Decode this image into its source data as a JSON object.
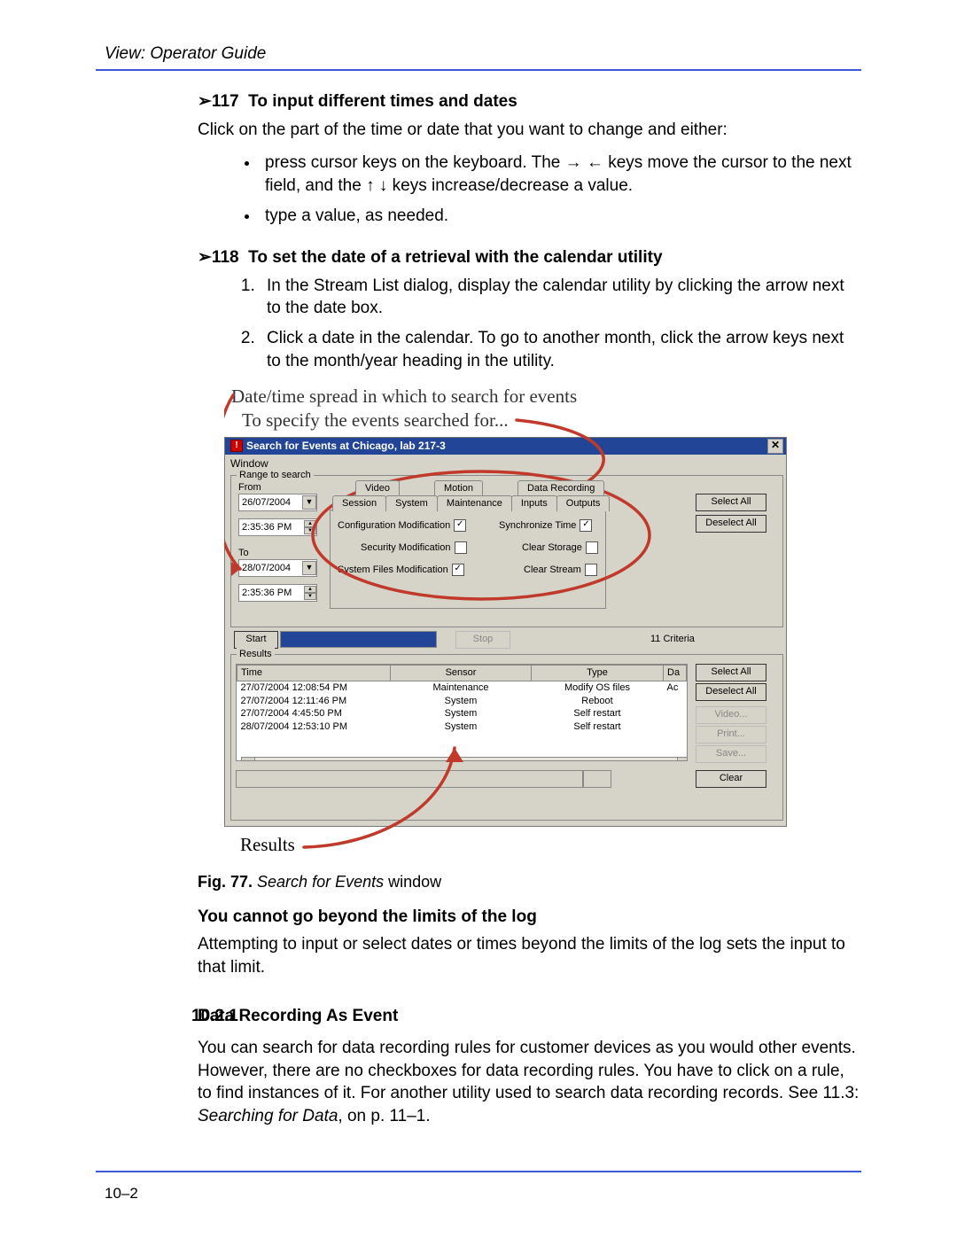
{
  "header": {
    "title": "View: Operator Guide"
  },
  "sec117": {
    "num": "117",
    "title": "To input different times and dates",
    "intro": "Click on the part of the time or date that you want to change and either:",
    "bullets": [
      "press cursor keys on the keyboard. The → ← keys move the cursor to the next field, and the ↑ ↓ keys increase/decrease a value.",
      "type a value, as needed."
    ]
  },
  "sec118": {
    "num": "118",
    "title": "To set the date of a retrieval with the calendar utility",
    "steps": [
      "In the Stream List dialog, display the calendar utility by clicking the arrow next to the date box.",
      "Click a date in the calendar. To go to another month, click the arrow keys next to the month/year heading in the utility."
    ]
  },
  "figure": {
    "anno_top1": "Date/time spread in which to search for events",
    "anno_top2": "To specify the events searched for...",
    "anno_bottom": "Results",
    "caption_label": "Fig. 77.",
    "caption_italic": "Search for Events",
    "caption_rest": " window"
  },
  "win": {
    "title": "Search for Events at Chicago, lab 217-3",
    "menu": "Window",
    "range_legend": "Range to search",
    "from_label": "From",
    "to_label": "To",
    "from_date": "26/07/2004",
    "from_time": "2:35:36 PM",
    "to_date": "28/07/2004",
    "to_time": "2:35:36 PM",
    "tabs_top": [
      "Video",
      "Motion",
      "Data Recording"
    ],
    "tabs_bot": [
      "Session",
      "System",
      "Maintenance",
      "Inputs",
      "Outputs"
    ],
    "checks_left": [
      {
        "label": "Configuration Modification",
        "checked": true
      },
      {
        "label": "Security Modification",
        "checked": false
      },
      {
        "label": "System Files Modification",
        "checked": true
      }
    ],
    "checks_right": [
      {
        "label": "Synchronize Time",
        "checked": true
      },
      {
        "label": "Clear Storage",
        "checked": false
      },
      {
        "label": "Clear Stream",
        "checked": false
      }
    ],
    "select_all": "Select All",
    "deselect_all": "Deselect All",
    "start": "Start",
    "stop": "Stop",
    "criteria": "11 Criteria",
    "results_legend": "Results",
    "results_headers": [
      "Time",
      "Sensor",
      "Type",
      "Da"
    ],
    "results_rows": [
      {
        "time": "27/07/2004 12:08:54 PM",
        "sensor": "Maintenance",
        "type": "Modify OS files",
        "d": "Ac"
      },
      {
        "time": "27/07/2004 12:11:46 PM",
        "sensor": "System",
        "type": "Reboot",
        "d": ""
      },
      {
        "time": "27/07/2004 4:45:50 PM",
        "sensor": "System",
        "type": "Self restart",
        "d": ""
      },
      {
        "time": "28/07/2004 12:53:10 PM",
        "sensor": "System",
        "type": "Self restart",
        "d": ""
      }
    ],
    "result_buttons": {
      "select_all": "Select All",
      "deselect_all": "Deselect All",
      "video": "Video...",
      "print": "Print...",
      "save": "Save...",
      "clear": "Clear"
    }
  },
  "limit": {
    "heading": "You cannot go beyond the limits of the log",
    "body": "Attempting to input or select dates or times beyond the limits of the log sets the input to that limit."
  },
  "sec1021": {
    "num": "10.2.1",
    "title": "Data Recording As Event",
    "body_a": "You can search for data recording rules for customer devices as you would other events. However, there are no checkboxes for data recording rules. You have to click on a rule, to find instances of it. For another utility used to search data recording records. See 11.3: ",
    "body_italic": "Searching for Data",
    "body_b": ", on p. 11–1."
  },
  "footer": {
    "page": "10–2"
  }
}
